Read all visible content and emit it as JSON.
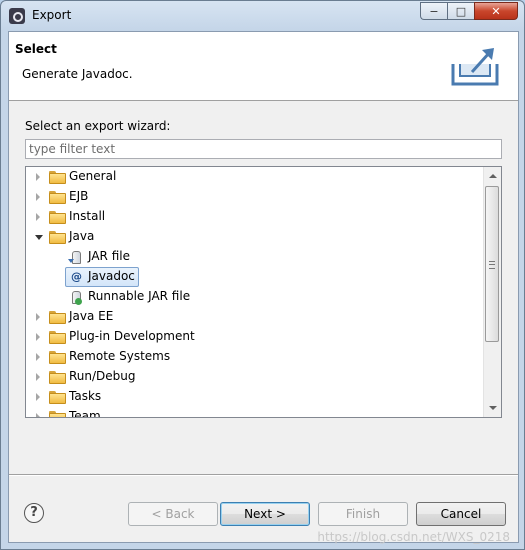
{
  "window": {
    "title": "Export",
    "caption_buttons": {
      "minimize": "−",
      "maximize": "□",
      "close": "✕"
    }
  },
  "header": {
    "title": "Select",
    "subtitle": "Generate Javadoc.",
    "art_icon": "export-wizard-icon"
  },
  "wizard": {
    "label": "Select an export wizard:",
    "filter_placeholder": "type filter text",
    "filter_value": ""
  },
  "tree": {
    "items": [
      {
        "label": "General",
        "icon": "folder-icon",
        "expanded": false
      },
      {
        "label": "EJB",
        "icon": "folder-icon",
        "expanded": false
      },
      {
        "label": "Install",
        "icon": "folder-icon",
        "expanded": false
      },
      {
        "label": "Java",
        "icon": "folder-icon",
        "expanded": true
      },
      {
        "label": "JAR file",
        "icon": "jar-file-icon"
      },
      {
        "label": "Javadoc",
        "icon": "javadoc-icon",
        "selected": true,
        "glyph": "@"
      },
      {
        "label": "Runnable JAR file",
        "icon": "runnable-jar-icon"
      },
      {
        "label": "Java EE",
        "icon": "folder-icon",
        "expanded": false
      },
      {
        "label": "Plug-in Development",
        "icon": "folder-icon",
        "expanded": false
      },
      {
        "label": "Remote Systems",
        "icon": "folder-icon",
        "expanded": false
      },
      {
        "label": "Run/Debug",
        "icon": "folder-icon",
        "expanded": false
      },
      {
        "label": "Tasks",
        "icon": "folder-icon",
        "expanded": false
      },
      {
        "label": "Team",
        "icon": "folder-icon",
        "expanded": false
      }
    ]
  },
  "buttons": {
    "help": "?",
    "back": "< Back",
    "next": "Next >",
    "finish": "Finish",
    "cancel": "Cancel"
  },
  "watermark": "https://blog.csdn.net/WXS_0218"
}
